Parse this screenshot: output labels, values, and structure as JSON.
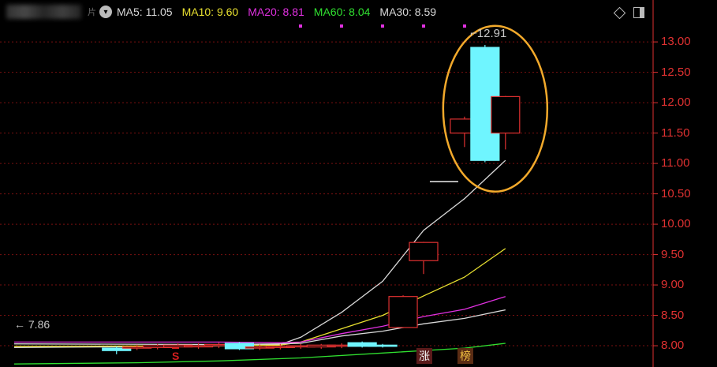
{
  "header": {
    "ma_items": [
      {
        "key": "ma5",
        "label": "MA5:",
        "value": "11.05",
        "color": "#d8d8d8"
      },
      {
        "key": "ma10",
        "label": "MA10:",
        "value": "9.60",
        "color": "#e8e030"
      },
      {
        "key": "ma20",
        "label": "MA20:",
        "value": "8.81",
        "color": "#e030e0"
      },
      {
        "key": "ma60",
        "label": "MA60:",
        "value": "8.04",
        "color": "#30e030"
      },
      {
        "key": "ma30",
        "label": "MA30:",
        "value": "8.59",
        "color": "#d8d8d8"
      }
    ],
    "toggle_glyph": "▾",
    "dot_char": "片"
  },
  "annotations": {
    "high_label": "12.91",
    "low_label": "7.86",
    "badge_zhang": "涨",
    "badge_bang": "榜",
    "badge_s": "S"
  },
  "chart_data": {
    "type": "candlestick",
    "ylim": [
      7.65,
      13.3
    ],
    "y_ticks": [
      "13.00",
      "12.50",
      "12.00",
      "11.50",
      "11.00",
      "10.50",
      "10.00",
      "9.50",
      "9.00",
      "8.50",
      "8.00"
    ],
    "x_count": 25,
    "candles": [
      {
        "o": 7.96,
        "h": 7.99,
        "l": 7.86,
        "c": 7.92
      },
      {
        "o": 7.96,
        "h": 8.02,
        "l": 7.93,
        "c": 7.98
      },
      {
        "o": 7.97,
        "h": 8.03,
        "l": 7.94,
        "c": 8.0
      },
      {
        "o": 7.98,
        "h": 8.04,
        "l": 7.95,
        "c": 8.01
      },
      {
        "o": 7.99,
        "h": 8.04,
        "l": 7.95,
        "c": 8.0
      },
      {
        "o": 8.0,
        "h": 8.05,
        "l": 7.96,
        "c": 8.02
      },
      {
        "o": 8.04,
        "h": 8.06,
        "l": 7.93,
        "c": 7.95
      },
      {
        "o": 7.97,
        "h": 8.02,
        "l": 7.93,
        "c": 7.98
      },
      {
        "o": 7.98,
        "h": 8.03,
        "l": 7.94,
        "c": 7.99
      },
      {
        "o": 7.99,
        "h": 8.03,
        "l": 7.95,
        "c": 8.0
      },
      {
        "o": 7.98,
        "h": 8.03,
        "l": 7.95,
        "c": 8.01
      },
      {
        "o": 8.0,
        "h": 8.04,
        "l": 7.96,
        "c": 8.01
      },
      {
        "o": 8.05,
        "h": 8.07,
        "l": 7.97,
        "c": 7.99
      },
      {
        "o": 8.01,
        "h": 8.03,
        "l": 7.97,
        "c": 7.99
      },
      {
        "o": 8.3,
        "h": 8.83,
        "l": 8.29,
        "c": 8.81
      },
      {
        "o": 9.4,
        "h": 9.71,
        "l": 9.18,
        "c": 9.7
      },
      {
        "o": 10.7,
        "h": 10.7,
        "l": 10.7,
        "c": 10.7
      },
      {
        "o": 11.5,
        "h": 11.77,
        "l": 11.27,
        "c": 11.73
      },
      {
        "o": 12.91,
        "h": 12.95,
        "l": 11.02,
        "c": 11.05
      },
      {
        "o": 11.5,
        "h": 12.11,
        "l": 11.23,
        "c": 12.1
      }
    ],
    "ma_lines": [
      {
        "name": "MA5",
        "color": "#d8d8d8",
        "points": [
          [
            0,
            7.97
          ],
          [
            9,
            7.99
          ],
          [
            13,
            8.02
          ],
          [
            14,
            8.14
          ],
          [
            16,
            8.55
          ],
          [
            18,
            9.06
          ],
          [
            20,
            9.9
          ],
          [
            22,
            10.42
          ],
          [
            24,
            11.05
          ]
        ]
      },
      {
        "name": "MA10",
        "color": "#e8e030",
        "points": [
          [
            0,
            7.99
          ],
          [
            9,
            8.0
          ],
          [
            13,
            8.01
          ],
          [
            14,
            8.06
          ],
          [
            16,
            8.28
          ],
          [
            18,
            8.5
          ],
          [
            20,
            8.82
          ],
          [
            22,
            9.13
          ],
          [
            24,
            9.6
          ]
        ]
      },
      {
        "name": "MA20",
        "color": "#e030e0",
        "points": [
          [
            0,
            8.06
          ],
          [
            10,
            8.06
          ],
          [
            13,
            8.05
          ],
          [
            14,
            8.06
          ],
          [
            16,
            8.2
          ],
          [
            18,
            8.32
          ],
          [
            20,
            8.48
          ],
          [
            22,
            8.6
          ],
          [
            24,
            8.81
          ]
        ]
      },
      {
        "name": "MA30",
        "color": "#d8d8d8",
        "points": [
          [
            0,
            8.03
          ],
          [
            10,
            8.02
          ],
          [
            13,
            8.03
          ],
          [
            14,
            8.04
          ],
          [
            16,
            8.16
          ],
          [
            18,
            8.24
          ],
          [
            20,
            8.36
          ],
          [
            22,
            8.45
          ],
          [
            24,
            8.59
          ]
        ]
      },
      {
        "name": "MA60",
        "color": "#30e030",
        "points": [
          [
            0,
            7.7
          ],
          [
            6,
            7.72
          ],
          [
            10,
            7.75
          ],
          [
            14,
            7.8
          ],
          [
            18,
            7.88
          ],
          [
            22,
            7.96
          ],
          [
            24,
            8.04
          ]
        ]
      }
    ],
    "annotation_ellipse": {
      "center_index": 23.5,
      "y_value": 11.9
    }
  },
  "colors": {
    "up": "#e03131",
    "down": "#6ff5ff",
    "flat": "#f0f0f0",
    "grid": "#7a1010",
    "axis": "#e03131",
    "ellipse": "#f2a92b"
  }
}
